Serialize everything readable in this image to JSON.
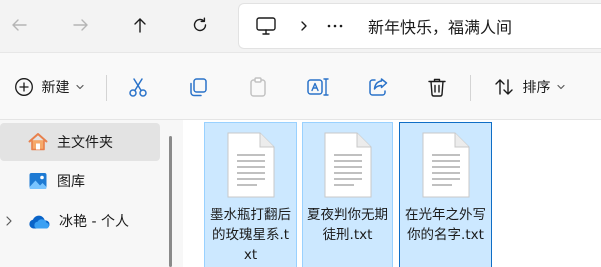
{
  "address_bar": {
    "path_label": "新年快乐，福满人间"
  },
  "toolbar": {
    "new_label": "新建",
    "sort_label": "排序"
  },
  "nav": {
    "items": [
      {
        "label": "主文件夹",
        "icon": "home-icon"
      },
      {
        "label": "图库",
        "icon": "gallery-icon"
      },
      {
        "label": "冰艳 - 个人",
        "icon": "onedrive-cloud-icon"
      }
    ]
  },
  "files": [
    {
      "name": "墨水瓶打翻后的玫瑰星系.txt",
      "icon": "text-file-icon"
    },
    {
      "name": "夏夜判你无期徒刑.txt",
      "icon": "text-file-icon"
    },
    {
      "name": "在光年之外写你的名字.txt",
      "icon": "text-file-icon"
    }
  ],
  "colors": {
    "selection_bg": "#cce8ff",
    "selection_border": "#99d1ff",
    "accent": "#0f6ec6"
  }
}
